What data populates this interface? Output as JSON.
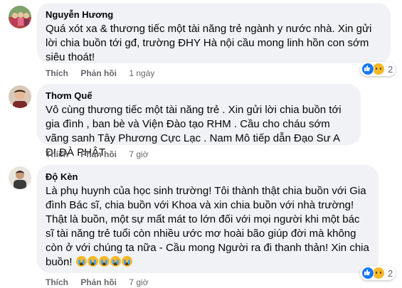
{
  "comments": [
    {
      "author": "Nguyễn Hương",
      "text": "Quá xót xa & thương tiếc một tài năng trẻ ngành y nước nhà. Xin gửi lời chia buồn tới gđ, trường ĐHY Hà nội cầu mong linh hồn con sớm siêu thoát!",
      "like_label": "Thích",
      "reply_label": "Phản hồi",
      "time": "1 ngày",
      "reaction_count": "2",
      "reaction_icons": [
        "like-icon",
        "sad-icon"
      ]
    },
    {
      "author": "Thơm Quế",
      "text": "Vô cùng thương tiếc một tài năng trẻ . Xin gửi lời chia buồn tới gia đình , ban bè và Viện Đào tạo RHM . Cầu cho cháu sớm vãng sanh Tây Phương Cực Lạc . Nam Mô tiếp dẫn Đạo Sư A DI ĐÀ PHẬT",
      "like_label": "Thích",
      "reply_label": "Phản hồi",
      "time": "7 giờ"
    },
    {
      "author": "Độ Kèn",
      "text": "Là phụ huynh của học sinh trường! Tôi thành thật chia buồn với Gia đình Bác sĩ, chia buồn với Khoa và xin chia buồn với nhà trường! Thật là buồn, một sự mất mát to lớn đối với mọi người khi một bác sĩ tài năng trẻ tuổi còn nhiều ước mơ hoài bão giúp đời mà không còn ở với chúng ta nữa - Cầu mong Người ra đi thanh thản! Xin chia buồn!",
      "like_label": "Thích",
      "reply_label": "Phản hồi",
      "time": "7 giờ",
      "reaction_count": "2",
      "reaction_icons": [
        "like-icon",
        "sad-icon"
      ],
      "emoji": "crying-face-icon"
    }
  ]
}
